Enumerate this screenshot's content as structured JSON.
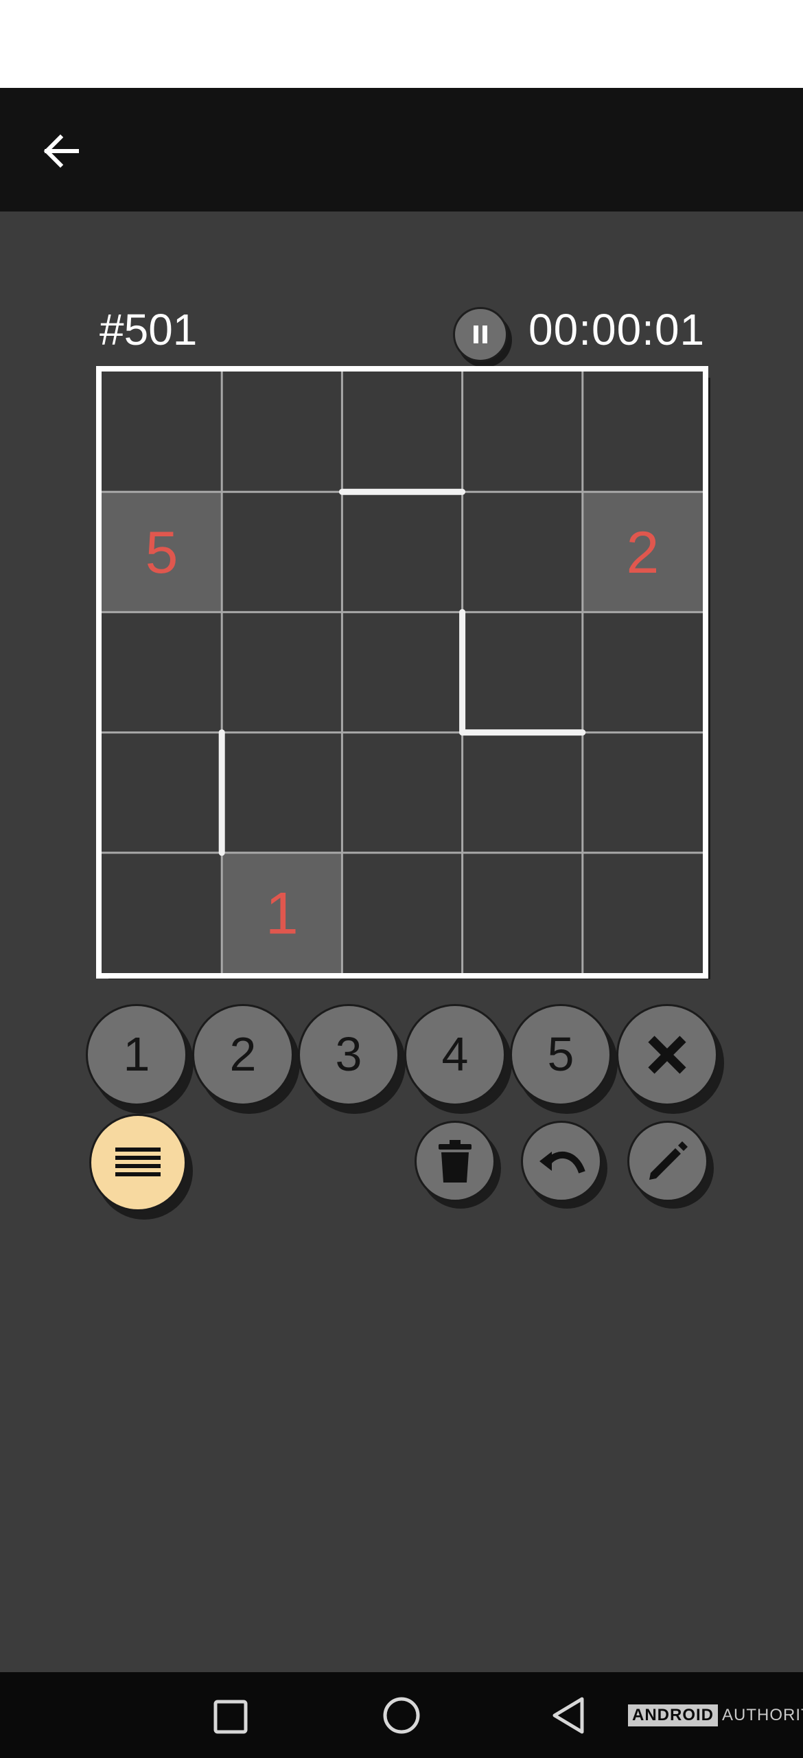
{
  "app": {
    "back_icon": "arrow-left-icon",
    "puzzle_id": "#501",
    "timer": "00:00:01",
    "pause_icon": "pause-icon"
  },
  "colors": {
    "background": "#3c3c3c",
    "appbar": "#121212",
    "clue_text": "#e0574e",
    "clue_cell": "#616161",
    "grid_line": "#a8a8a8",
    "board_border": "#ffffff",
    "menu_button": "#f7d9a0"
  },
  "board": {
    "rows": 5,
    "cols": 5,
    "clues": [
      {
        "row": 1,
        "col": 0,
        "value": "5"
      },
      {
        "row": 1,
        "col": 4,
        "value": "2"
      },
      {
        "row": 4,
        "col": 1,
        "value": "1"
      }
    ],
    "walls": [
      {
        "type": "h",
        "line": 1,
        "from": 2,
        "to": 3
      },
      {
        "type": "v",
        "line": 3,
        "from": 2,
        "to": 3
      },
      {
        "type": "h",
        "line": 3,
        "from": 3,
        "to": 4
      },
      {
        "type": "v",
        "line": 1,
        "from": 3,
        "to": 4
      }
    ]
  },
  "number_pad": [
    "1",
    "2",
    "3",
    "4",
    "5"
  ],
  "actions": {
    "clear_icon": "close-icon",
    "menu_icon": "menu-icon",
    "delete_icon": "trash-icon",
    "undo_icon": "undo-icon",
    "edit_icon": "pencil-icon"
  },
  "navbar": {
    "recents_icon": "square-icon",
    "home_icon": "circle-icon",
    "back_icon": "triangle-back-icon"
  },
  "watermark": {
    "brand": "ANDROID",
    "suffix": "AUTHORITY"
  }
}
